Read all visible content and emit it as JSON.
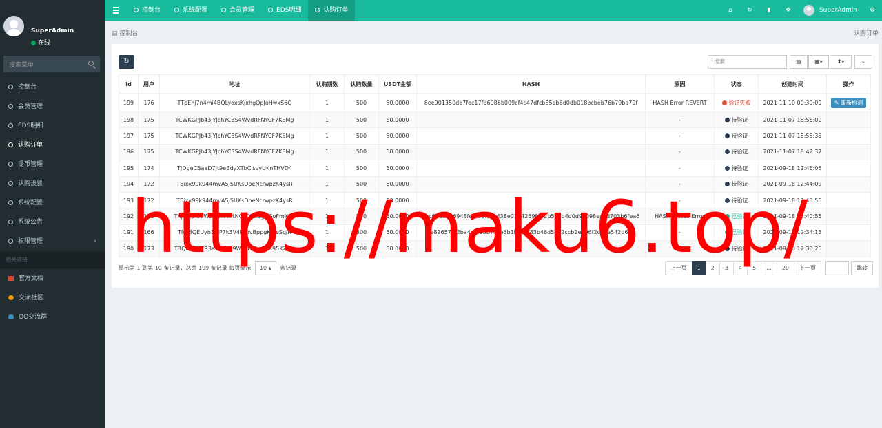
{
  "sidebar": {
    "user": {
      "name": "SuperAdmin",
      "status": "在线"
    },
    "search_placeholder": "搜索菜单",
    "items": [
      {
        "label": "控制台"
      },
      {
        "label": "会员管理"
      },
      {
        "label": "EDS明细"
      },
      {
        "label": "认购订单",
        "active": true
      },
      {
        "label": "提币管理"
      },
      {
        "label": "认购设置"
      },
      {
        "label": "系统配置"
      },
      {
        "label": "系统公告"
      },
      {
        "label": "权限管理",
        "chevron": "‹"
      }
    ],
    "links_header": "相关链接",
    "links": [
      {
        "label": "官方文档",
        "color": "#dd4b39"
      },
      {
        "label": "交流社区",
        "color": "#f39c12"
      },
      {
        "label": "QQ交流群",
        "color": "#3c8dbc"
      }
    ]
  },
  "topbar": {
    "tabs": [
      "控制台",
      "系统配置",
      "会员管理",
      "EDS明细",
      "认购订单"
    ],
    "active_tab": "认购订单",
    "user_name": "SuperAdmin",
    "accent": "#18bc9c"
  },
  "breadcrumb": {
    "left": "控制台",
    "right": "认购订单"
  },
  "toolbar": {
    "search_placeholder": "搜索"
  },
  "table": {
    "columns": [
      "Id",
      "用户",
      "地址",
      "认购期数",
      "认购数量",
      "USDT金额",
      "HASH",
      "原因",
      "状态",
      "创建时间",
      "操作"
    ],
    "rows": [
      [
        "199",
        "176",
        "TTpEhj7n4mi4BQLyexsKjxhgQpJoHwxS6Q",
        "1",
        "500",
        "50.0000",
        "8ee901350de7fec17fb6986b009cf4c47dfcb85eb6d0db018bcbeb76b79ba79f",
        "HASH Error REVERT",
        "验证失败",
        "2021-11-10 00:30:09",
        "重新检测"
      ],
      [
        "198",
        "175",
        "TCWKGPJb43jYJchYC3S4WvdRFNYCF7KEMg",
        "1",
        "500",
        "50.0000",
        "",
        "-",
        "待验证",
        "2021-11-07 18:56:00",
        ""
      ],
      [
        "197",
        "175",
        "TCWKGPJb43jYJchYC3S4WvdRFNYCF7KEMg",
        "1",
        "500",
        "50.0000",
        "",
        "-",
        "待验证",
        "2021-11-07 18:55:35",
        ""
      ],
      [
        "196",
        "175",
        "TCWKGPJb43jYJchYC3S4WvdRFNYCF7KEMg",
        "1",
        "500",
        "50.0000",
        "",
        "-",
        "待验证",
        "2021-11-07 18:42:37",
        ""
      ],
      [
        "195",
        "174",
        "TJDgeCBaaD7Jt9eBdyXTbCisvyUKnTHVD4",
        "1",
        "500",
        "50.0000",
        "",
        "-",
        "待验证",
        "2021-09-18 12:46:05",
        ""
      ],
      [
        "194",
        "172",
        "TBixx99k944mvA5JSUKsDbeNcrwpzK4ysR",
        "1",
        "500",
        "50.0000",
        "",
        "-",
        "待验证",
        "2021-09-18 12:44:09",
        ""
      ],
      [
        "193",
        "172",
        "TBixx99k944mvA5JSUKsDbeNcrwpzK4ysR",
        "1",
        "500",
        "50.0000",
        "",
        "-",
        "待验证",
        "2021-09-18 12:43:56",
        ""
      ],
      [
        "192",
        "171",
        "TKJQQpiuVWzWpfvvPtNGtQkGZgXGoFmX11",
        "1",
        "500",
        "50.0000",
        "0cc63d5816948fef7b9f9ec438e0374269fe92b55eb4d0d9e098eaed703b6fea6",
        "HASH Status Error",
        "已验证",
        "2021-09-18 12:40:55",
        ""
      ],
      [
        "191",
        "166",
        "TNT3QEUyb3MP7k3V4RYovBppgKJ5eSgJR",
        "1",
        "500",
        "50.0000",
        "e82657f32ba4a1f93b7cde5b1b48af83b46d5b42ccb2e706f2c28e542d65",
        "-",
        "已验证",
        "2021-09-18 12:34:13",
        ""
      ],
      [
        "190",
        "173",
        "TBQF2RMTR3aSPTLG9WLrTE9w7xX95KZrsa",
        "1",
        "500",
        "50.0000",
        "",
        "-",
        "待验证",
        "2021-09-18 12:33:25",
        ""
      ]
    ],
    "status_colors": {
      "验证失败": "#dd4b39",
      "待验证": "#2c3e50",
      "已验证": "#18bc9c"
    }
  },
  "footer": {
    "info_prefix": "显示第 1 到第 10 条记录，总共 199 条记录 每页显示",
    "page_size": "10",
    "info_suffix": "条记录",
    "pagination": [
      "上一页",
      "1",
      "2",
      "3",
      "4",
      "5",
      "...",
      "20",
      "下一页"
    ],
    "active_page": "1",
    "go_label": "跳转"
  },
  "watermark": "https://maku6.top/"
}
